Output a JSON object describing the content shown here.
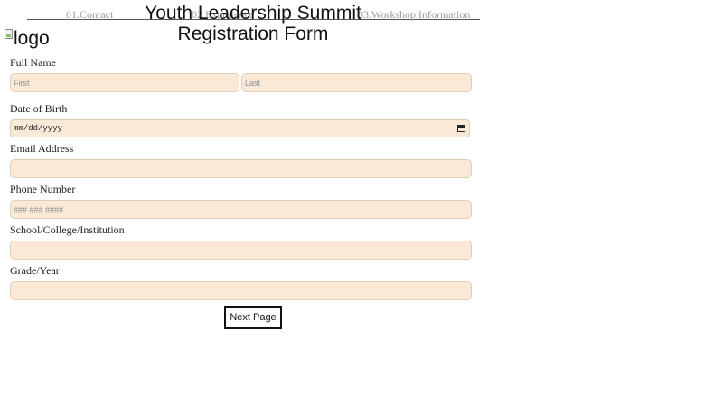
{
  "nav": {
    "steps": [
      {
        "label": "01.Contact"
      },
      {
        "label": "02.Experience"
      },
      {
        "label": "03.Workshop Information"
      }
    ]
  },
  "header": {
    "title": "Youth Leadership Summit Registration Form",
    "logo_alt": "logo"
  },
  "form": {
    "full_name": {
      "label": "Full Name",
      "first_placeholder": "First",
      "last_placeholder": "Last"
    },
    "dob": {
      "label": "Date of Birth",
      "value": "mm/dd/yyyy"
    },
    "email": {
      "label": "Email Address",
      "placeholder": ""
    },
    "phone": {
      "label": "Phone Number",
      "placeholder": "### ### ####"
    },
    "school": {
      "label": "School/College/Institution",
      "placeholder": ""
    },
    "grade": {
      "label": "Grade/Year",
      "placeholder": ""
    },
    "next_label": "Next Page"
  },
  "colors": {
    "field_background": "#fbe9d8",
    "step_text": "#9a9a9a"
  }
}
